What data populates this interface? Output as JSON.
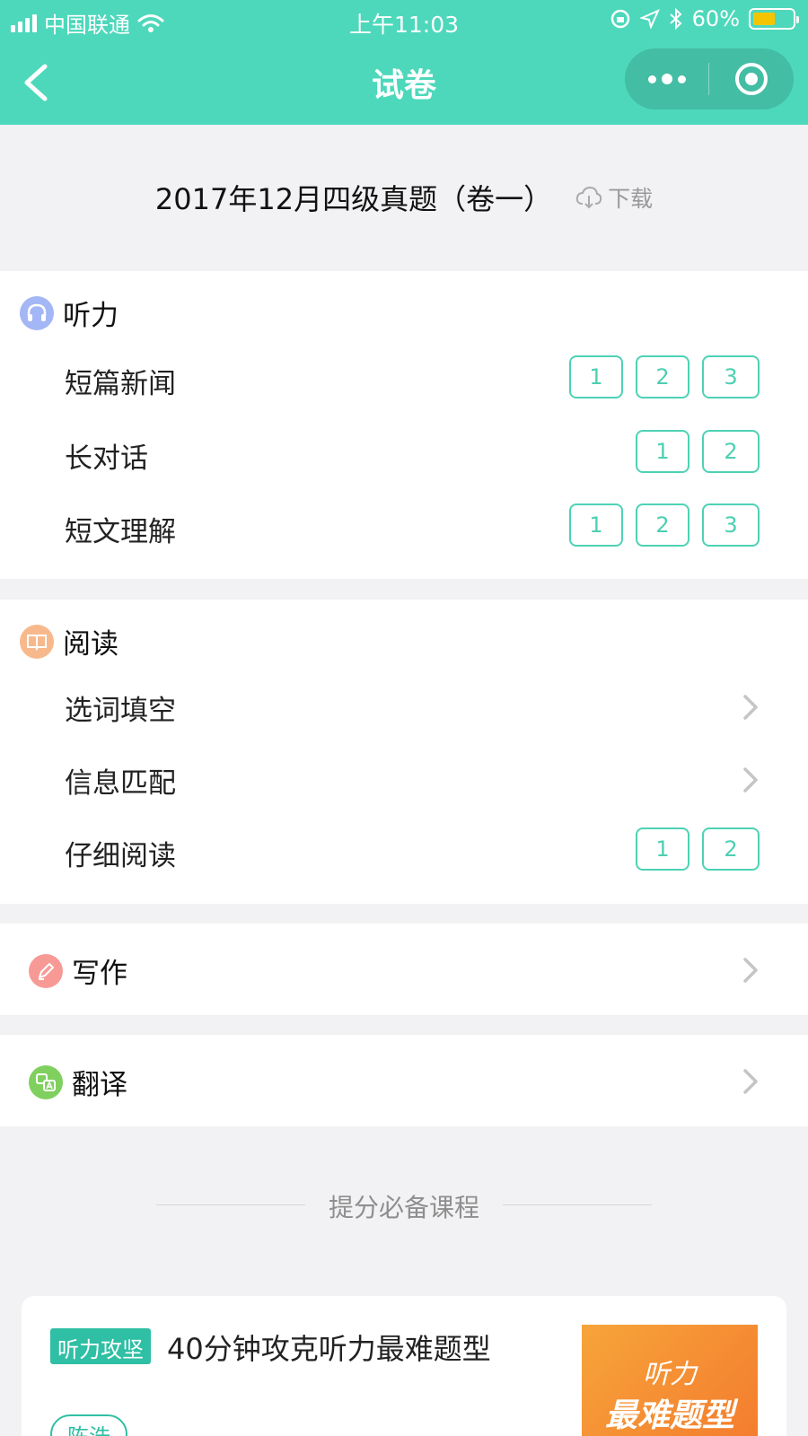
{
  "status_bar": {
    "carrier": "中国联通",
    "time": "上午11:03",
    "battery": "60%",
    "battery_level": 0.6,
    "battery_color": "#f5c400"
  },
  "nav": {
    "title": "试卷",
    "back_icon": "chevron-left-icon",
    "more_icon": "more-dots-icon",
    "close_icon": "target-circle-icon"
  },
  "exam": {
    "title": "2017年12月四级真题（卷一）",
    "download_label": "下载",
    "download_icon": "cloud-download-icon"
  },
  "sections": {
    "listening": {
      "label": "听力",
      "icon": "headphones-icon",
      "icon_color": "#a3b6f5",
      "rows": [
        {
          "name": "短篇新闻",
          "parts": [
            "1",
            "2",
            "3"
          ]
        },
        {
          "name": "长对话",
          "parts": [
            "1",
            "2"
          ]
        },
        {
          "name": "短文理解",
          "parts": [
            "1",
            "2",
            "3"
          ]
        }
      ]
    },
    "reading": {
      "label": "阅读",
      "icon": "book-icon",
      "icon_color": "#f7b98c",
      "rows": [
        {
          "name": "选词填空"
        },
        {
          "name": "信息匹配"
        },
        {
          "name": "仔细阅读",
          "parts": [
            "1",
            "2"
          ]
        }
      ]
    },
    "writing": {
      "label": "写作",
      "icon": "pen-icon",
      "icon_color": "#f79a96"
    },
    "translation": {
      "label": "翻译",
      "icon": "translate-icon",
      "icon_color": "#7fd05e"
    }
  },
  "recommend": {
    "heading": "提分必备课程"
  },
  "course": {
    "tag": "听力攻坚",
    "title": "40分钟攻克听力最难题型",
    "teacher": "陈浩",
    "thumb_line1": "听力",
    "thumb_line2": "最难题型",
    "accent": "#2fbfa4"
  }
}
